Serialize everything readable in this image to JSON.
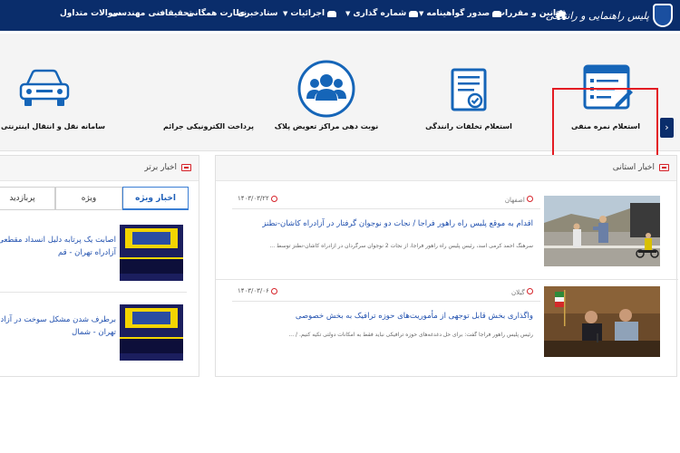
{
  "colors": {
    "nav_bg": "#0a2d6b",
    "highlight_border": "#e31b23",
    "link_blue": "#1f4fae",
    "icon_blue": "#1565b8"
  },
  "header": {
    "logo_text": "پلیس راهنمایی و رانندگی",
    "logo_icon": "police-shield-icon",
    "home_icon": "home-icon",
    "nav": [
      {
        "label": "قوانین و مقررات",
        "icon": ""
      },
      {
        "label": "صدور گواهینامه",
        "icon": "car-icon",
        "dropdown": true
      },
      {
        "label": "شماره گذاری",
        "icon": "car-icon",
        "dropdown": true
      },
      {
        "label": "اجرائیات",
        "icon": "car-icon",
        "dropdown": true
      },
      {
        "label": "ستادخبری",
        "icon": ""
      },
      {
        "label": "نظارت همگانی",
        "icon": ""
      },
      {
        "label": "تحقیقات",
        "icon": ""
      },
      {
        "label": "فنی مهندسی",
        "icon": ""
      },
      {
        "label": "سوالات متداول",
        "icon": ""
      }
    ]
  },
  "services": [
    {
      "label": "استعلام نمره منفی",
      "icon": "form-edit-icon",
      "selected": true
    },
    {
      "label": "استعلام تخلفات رانندگی",
      "icon": "document-check-icon",
      "selected": false
    },
    {
      "label": "نوبت دهی مراکز تعویض پلاک",
      "icon": "group-users-icon",
      "selected": false
    },
    {
      "label": "پرداخت الکترونیکی جرائم",
      "icon": "",
      "selected": false
    },
    {
      "label": "سامانه نقل و انتقال اینترنتی خودرو",
      "icon": "car-icon",
      "selected": false
    }
  ],
  "services_next_icon": "chevron-right-icon",
  "provincial_news": {
    "title": "اخبار استانی",
    "items": [
      {
        "province": "اصفهان",
        "date": "۱۴۰۳/۰۳/۲۲",
        "title": "اقدام به موقع پلیس راه راهور فراجا / نجات دو نوجوان گرفتار در آزادراه کاشان-نطنز",
        "summary": "سرهنگ احمد کرمی اسد، رئیس پلیس راه راهور فراجا، از نجات 2 نوجوان سرگردان در آزادراه کاشان-نطنز توسط ..."
      },
      {
        "province": "گیلان",
        "date": "۱۴۰۳/۰۳/۰۶",
        "title": "واگذاری بخش قابل توجهی از مأموریت‌های حوزه ترافیک به بخش خصوصی",
        "summary": "رئیس پلیس راهور فراجا گفت: برای حل دغدغه‌های حوزه ترافیکی نباید فقط به امکانات دولتی تکیه کنیم. / ..."
      }
    ]
  },
  "top_news": {
    "title": "اخبار برتر",
    "tabs": [
      "اخبار ویژه",
      "ویژه",
      "پربازدید"
    ],
    "items": [
      {
        "title": "اصابت یک پرتابه دلیل انسداد مقطعی آزادراه تهران - قم"
      },
      {
        "title": "برطرف شدن مشکل سوخت در آزادراه تهران - شمال"
      }
    ]
  }
}
